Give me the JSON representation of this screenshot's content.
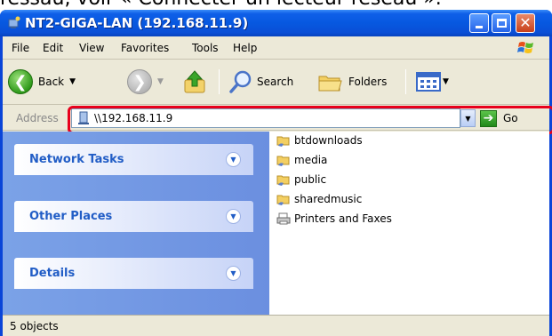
{
  "caption": "ressau, voir « Connecter un lecteur réseau ».",
  "window": {
    "title": "NT2-GIGA-LAN (192.168.11.9)",
    "controls": {
      "minimize": "minimize",
      "maximize": "maximize",
      "close": "close"
    }
  },
  "menu": {
    "items": [
      "File",
      "Edit",
      "View",
      "Favorites",
      "Tools",
      "Help"
    ]
  },
  "toolbar": {
    "back_label": "Back",
    "search_label": "Search",
    "folders_label": "Folders"
  },
  "address": {
    "label": "Address",
    "value": "\\\\192.168.11.9",
    "go_label": "Go"
  },
  "taskpane": {
    "sections": [
      {
        "title": "Network Tasks"
      },
      {
        "title": "Other Places"
      },
      {
        "title": "Details"
      }
    ]
  },
  "files": [
    {
      "name": "btdownloads",
      "icon": "shared-folder-icon"
    },
    {
      "name": "media",
      "icon": "shared-folder-icon"
    },
    {
      "name": "public",
      "icon": "shared-folder-icon"
    },
    {
      "name": "sharedmusic",
      "icon": "shared-folder-icon"
    },
    {
      "name": "Printers and Faxes",
      "icon": "printer-icon"
    }
  ],
  "status": {
    "text": "5 objects"
  },
  "colors": {
    "titlebar": "#0758e0",
    "highlight": "#e8001c",
    "taskpane": "#7ba2e7",
    "task_title": "#215dc6"
  }
}
